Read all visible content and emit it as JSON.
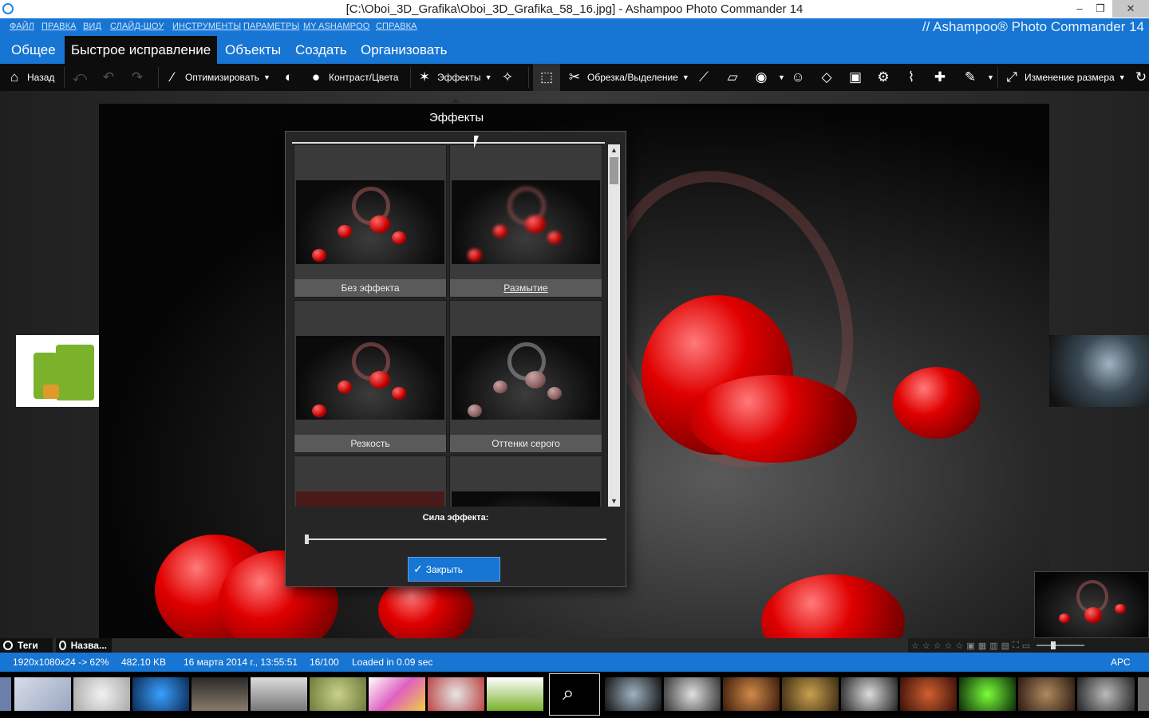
{
  "window": {
    "title": "[C:\\Oboi_3D_Grafika\\Oboi_3D_Grafika_58_16.jpg] - Ashampoo Photo Commander 14",
    "minimize": "–",
    "restore": "❐",
    "close": "✕"
  },
  "menu": {
    "items": [
      "ФАЙЛ",
      "ПРАВКА",
      "ВИД",
      "СЛАЙД-ШОУ",
      "ИНСТРУМЕНТЫ",
      "ПАРАМЕТРЫ",
      "MY ASHAMPOO",
      "СПРАВКА"
    ],
    "brand": "// Ashampoo® Photo Commander 14"
  },
  "tabs": [
    "Общее",
    "Быстрое исправление",
    "Объекты",
    "Создать",
    "Организовать"
  ],
  "toolbar": {
    "back": "Назад",
    "optimize": "Оптимизировать",
    "contrast": "Контраст/Цвета",
    "effects": "Эффекты",
    "crop": "Обрезка/Выделение",
    "resize": "Изменение размера"
  },
  "effects_dialog": {
    "title": "Эффекты",
    "items": [
      {
        "label": "Без эффекта",
        "style": "normal"
      },
      {
        "label": "Размытие",
        "style": "blur"
      },
      {
        "label": "Резкость",
        "style": "normal"
      },
      {
        "label": "Оттенки серого",
        "style": "grey"
      }
    ],
    "strength_label": "Сила эффекта:",
    "strength": 0,
    "close_button": "Закрыть"
  },
  "lower_panel": {
    "tags_label": "Теги",
    "name_label": "Назва..."
  },
  "status": {
    "dimensions": "1920x1080x24 -> 62%",
    "filesize": "482.10 KB",
    "date": "16 марта 2014 г., 13:55:51",
    "index": "16/100",
    "loaded": "Loaded in 0.09 sec",
    "layout": "APC"
  },
  "colors": {
    "accent": "#1775d3",
    "toolbar_bg": "#0d0d0d",
    "dialog_bg": "#262626"
  }
}
